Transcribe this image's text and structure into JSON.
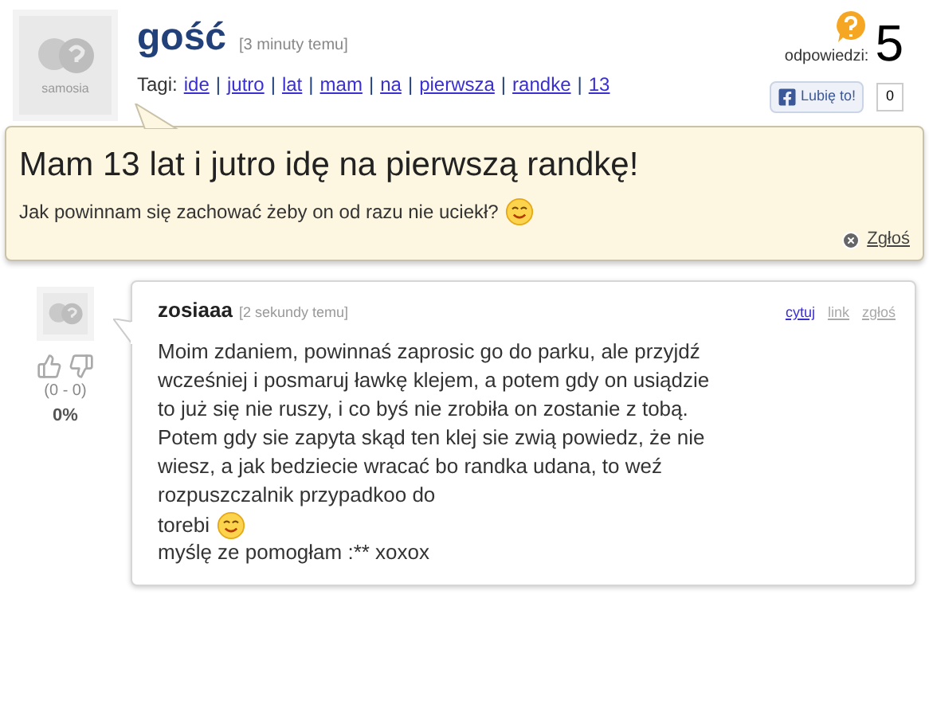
{
  "question": {
    "author": "gość",
    "time": "[3 minuty temu]",
    "avatar_label": "samosia",
    "tags_label": "Tagi:",
    "tag_separator": "|",
    "tags": [
      "ide",
      "jutro",
      "lat",
      "mam",
      "na",
      "pierwsza",
      "randke",
      "13"
    ],
    "answers_label": "odpowiedzi:",
    "answers_count": "5",
    "like_button": "Lubię to!",
    "like_count": "0",
    "title": "Mam 13 lat i jutro idę na pierwszą randkę!",
    "body": "Jak powinnam się zachować żeby on od razu nie uciekł?",
    "report": "Zgłoś"
  },
  "answer": {
    "author": "zosiaaa",
    "time": "[2 sekundy temu]",
    "links": [
      "cytuj",
      "link",
      "zgłoś"
    ],
    "votes": "(0 - 0)",
    "percent": "0%",
    "body": "Moim zdaniem, powinnaś zaprosic go do parku, ale przyjdź wcześniej i posmaruj ławkę klejem, a potem gdy on usiądzie to już się nie ruszy, i co byś nie zrobiła on zostanie z tobą. Potem gdy sie zapyta skąd ten klej sie zwią powiedz, że nie wiesz, a jak bedziecie wracać bo randka udana, to weź rozpuszczalnik przypadkoo do",
    "body_end": "torebi",
    "signoff": "myślę ze pomogłam :** xoxox"
  }
}
